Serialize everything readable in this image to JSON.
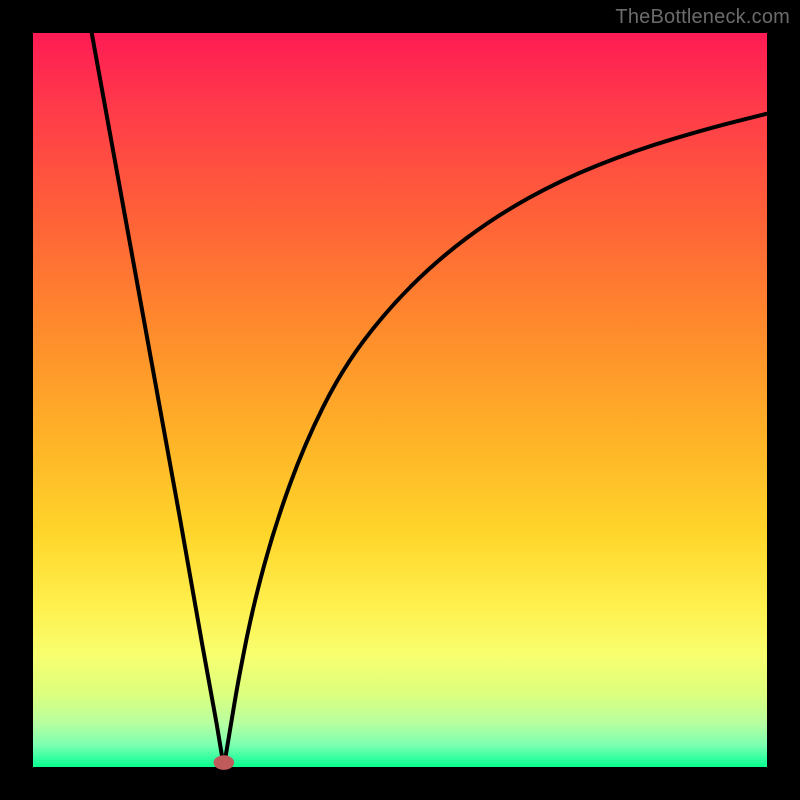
{
  "watermark": {
    "text": "TheBottleneck.com"
  },
  "colors": {
    "background": "#000000",
    "curve_stroke": "#000000",
    "marker_fill": "#c05b5b",
    "gradient_stops": [
      "#ff1b54",
      "#ff3a4a",
      "#ff6138",
      "#ff8a2c",
      "#ffb228",
      "#ffd52a",
      "#fff04d",
      "#f7ff70",
      "#dcff7d",
      "#b8ffa0",
      "#7bffb0",
      "#2cff9e",
      "#0aff8c"
    ]
  },
  "chart_data": {
    "type": "line",
    "title": "",
    "xlabel": "",
    "ylabel": "",
    "xlim": [
      0,
      100
    ],
    "ylim": [
      0,
      100
    ],
    "grid": false,
    "series": [
      {
        "name": "left-branch",
        "x": [
          8,
          12,
          16,
          20,
          23,
          25,
          26
        ],
        "values": [
          100,
          78,
          56,
          34,
          17,
          6,
          0
        ]
      },
      {
        "name": "right-branch",
        "x": [
          26,
          27,
          28,
          30,
          33,
          37,
          42,
          48,
          55,
          63,
          72,
          82,
          92,
          100
        ],
        "values": [
          0,
          6,
          12,
          22,
          33,
          44,
          54,
          62,
          69,
          75,
          80,
          84,
          87,
          89
        ]
      }
    ],
    "marker": {
      "x": 26,
      "y": 0,
      "radius_pct": 1.2
    },
    "notes": "Values are percentages of plot width/height estimated from the image; y increases upward."
  }
}
